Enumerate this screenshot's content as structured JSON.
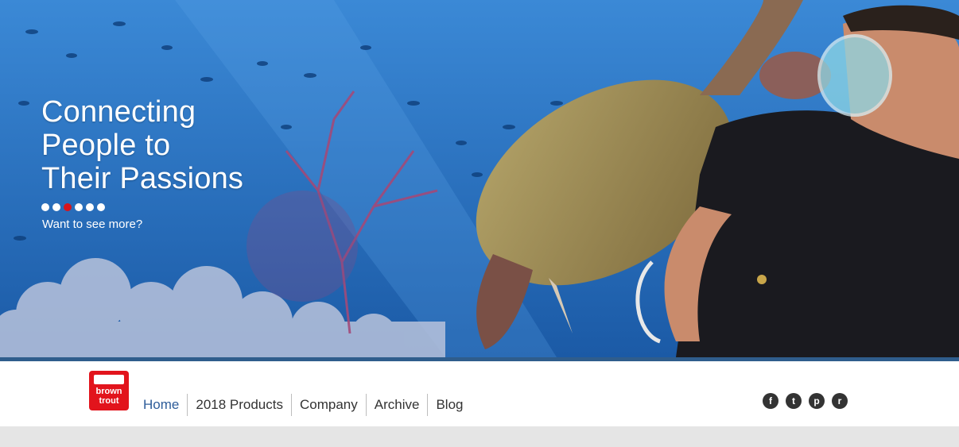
{
  "hero": {
    "headline": "Connecting\nPeople to\nTheir Passions",
    "see_more": "Want to see more?",
    "slides_total": 6,
    "active_slide": 3,
    "active_dot_color": "#d8141b"
  },
  "logo": {
    "line1": "brown",
    "line2": "trout",
    "color": "#e2141c"
  },
  "nav": {
    "items": [
      {
        "label": "Home"
      },
      {
        "label": "2018 Products"
      },
      {
        "label": "Company"
      },
      {
        "label": "Archive"
      },
      {
        "label": "Blog"
      }
    ],
    "active_color": "#2e5d9a"
  },
  "social": {
    "facebook": "f",
    "twitter": "t",
    "pinterest": "p",
    "rss": "r"
  }
}
